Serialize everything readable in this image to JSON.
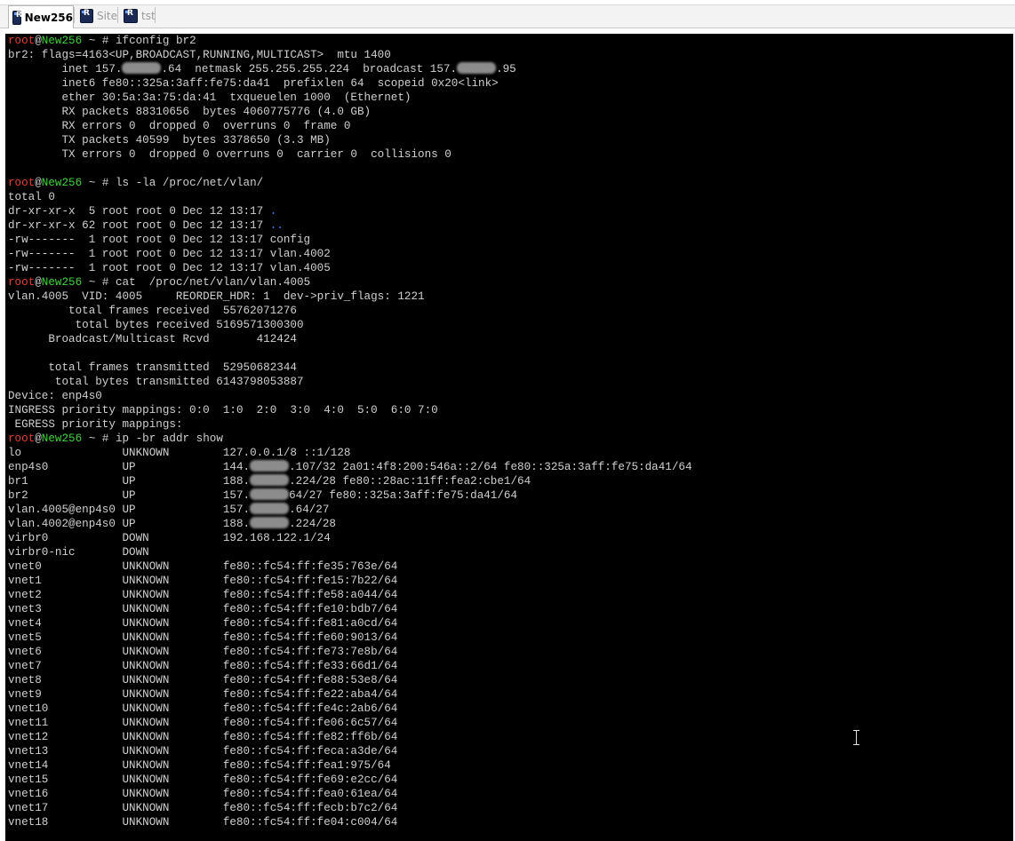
{
  "tabs": [
    {
      "label": "New256",
      "active": true
    },
    {
      "label": "Site",
      "active": false
    },
    {
      "label": "tst",
      "active": false
    }
  ],
  "prompt": {
    "user": "root",
    "at": "@",
    "host": "New256",
    "rest": " ~ # "
  },
  "terminal": {
    "line0": {
      "cmd": "ifconfig br2"
    },
    "line1": {
      "text": "br2: flags=4163<UP,BROADCAST,RUNNING,MULTICAST>  mtu 1400"
    },
    "line2": {
      "a": "        inet 157.",
      "b": ".64  netmask 255.255.255.224  broadcast 157.",
      "c": ".95"
    },
    "line3": {
      "text": "        inet6 fe80::325a:3aff:fe75:da41  prefixlen 64  scopeid 0x20<link>"
    },
    "line4": {
      "text": "        ether 30:5a:3a:75:da:41  txqueuelen 1000  (Ethernet)"
    },
    "line5": {
      "text": "        RX packets 88310656  bytes 4060775776 (4.0 GB)"
    },
    "line6": {
      "text": "        RX errors 0  dropped 0  overruns 0  frame 0"
    },
    "line7": {
      "text": "        TX packets 40599  bytes 3378650 (3.3 MB)"
    },
    "line8": {
      "text": "        TX errors 0  dropped 0 overruns 0  carrier 0  collisions 0"
    },
    "line9": {
      "text": ""
    },
    "line10": {
      "cmd": "ls -la /proc/net/vlan/"
    },
    "line11": {
      "text": "total 0"
    },
    "line12": {
      "a": "dr-xr-xr-x  5 root root 0 Dec 12 13:17 ",
      "d": "."
    },
    "line13": {
      "a": "dr-xr-xr-x 62 root root 0 Dec 12 13:17 ",
      "d": ".."
    },
    "line14": {
      "text": "-rw-------  1 root root 0 Dec 12 13:17 config"
    },
    "line15": {
      "text": "-rw-------  1 root root 0 Dec 12 13:17 vlan.4002"
    },
    "line16": {
      "text": "-rw-------  1 root root 0 Dec 12 13:17 vlan.4005"
    },
    "line17": {
      "cmd": "cat  /proc/net/vlan/vlan.4005"
    },
    "line18": {
      "text": "vlan.4005  VID: 4005     REORDER_HDR: 1  dev->priv_flags: 1221"
    },
    "line19": {
      "text": "         total frames received  55762071276"
    },
    "line20": {
      "text": "          total bytes received 5169571300300"
    },
    "line21": {
      "text": "      Broadcast/Multicast Rcvd       412424"
    },
    "line22": {
      "text": ""
    },
    "line23": {
      "text": "      total frames transmitted  52950682344"
    },
    "line24": {
      "text": "       total bytes transmitted 6143798053887"
    },
    "line25": {
      "text": "Device: enp4s0"
    },
    "line26": {
      "text": "INGRESS priority mappings: 0:0  1:0  2:0  3:0  4:0  5:0  6:0 7:0"
    },
    "line27": {
      "text": " EGRESS priority mappings:"
    },
    "line28": {
      "cmd": "ip -br addr show"
    },
    "line29": {
      "text": "lo               UNKNOWN        127.0.0.1/8 ::1/128"
    },
    "line30": {
      "a": "enp4s0           UP             144.",
      "b": ".107/32 2a01:4f8:200:546a::2/64 fe80::325a:3aff:fe75:da41/64"
    },
    "line31": {
      "a": "br1              UP             188.",
      "b": ".224/28 fe80::28ac:11ff:fea2:cbe1/64"
    },
    "line32": {
      "a": "br2              UP             157.",
      "b": "64/27 fe80::325a:3aff:fe75:da41/64"
    },
    "line33": {
      "a": "vlan.4005@enp4s0 UP             157.",
      "b": ".64/27"
    },
    "line34": {
      "a": "vlan.4002@enp4s0 UP             188.",
      "b": ".224/28"
    },
    "line35": {
      "text": "virbr0           DOWN           192.168.122.1/24"
    },
    "line36": {
      "text": "virbr0-nic       DOWN"
    },
    "line37": {
      "text": "vnet0            UNKNOWN        fe80::fc54:ff:fe35:763e/64"
    },
    "line38": {
      "text": "vnet1            UNKNOWN        fe80::fc54:ff:fe15:7b22/64"
    },
    "line39": {
      "text": "vnet2            UNKNOWN        fe80::fc54:ff:fe58:a044/64"
    },
    "line40": {
      "text": "vnet3            UNKNOWN        fe80::fc54:ff:fe10:bdb7/64"
    },
    "line41": {
      "text": "vnet4            UNKNOWN        fe80::fc54:ff:fe81:a0cd/64"
    },
    "line42": {
      "text": "vnet5            UNKNOWN        fe80::fc54:ff:fe60:9013/64"
    },
    "line43": {
      "text": "vnet6            UNKNOWN        fe80::fc54:ff:fe73:7e8b/64"
    },
    "line44": {
      "text": "vnet7            UNKNOWN        fe80::fc54:ff:fe33:66d1/64"
    },
    "line45": {
      "text": "vnet8            UNKNOWN        fe80::fc54:ff:fe88:53e8/64"
    },
    "line46": {
      "text": "vnet9            UNKNOWN        fe80::fc54:ff:fe22:aba4/64"
    },
    "line47": {
      "text": "vnet10           UNKNOWN        fe80::fc54:ff:fe4c:2ab6/64"
    },
    "line48": {
      "text": "vnet11           UNKNOWN        fe80::fc54:ff:fe06:6c57/64"
    },
    "line49": {
      "text": "vnet12           UNKNOWN        fe80::fc54:ff:fe82:ff6b/64"
    },
    "line50": {
      "text": "vnet13           UNKNOWN        fe80::fc54:ff:feca:a3de/64"
    },
    "line51": {
      "text": "vnet14           UNKNOWN        fe80::fc54:ff:fea1:975/64"
    },
    "line52": {
      "text": "vnet15           UNKNOWN        fe80::fc54:ff:fe69:e2cc/64"
    },
    "line53": {
      "text": "vnet16           UNKNOWN        fe80::fc54:ff:fea0:61ea/64"
    },
    "line54": {
      "text": "vnet17           UNKNOWN        fe80::fc54:ff:fecb:b7c2/64"
    },
    "line55": {
      "text": "vnet18           UNKNOWN        fe80::fc54:ff:fe04:c004/64"
    }
  },
  "colors": {
    "terminal_bg": "#000000",
    "prompt_user": "#e5413a",
    "prompt_host": "#3fd33a",
    "dir_color": "#4a7bff"
  },
  "icons": {
    "tab_icon": "putty-terminal-icon",
    "cursor": "text-cursor-icon"
  }
}
